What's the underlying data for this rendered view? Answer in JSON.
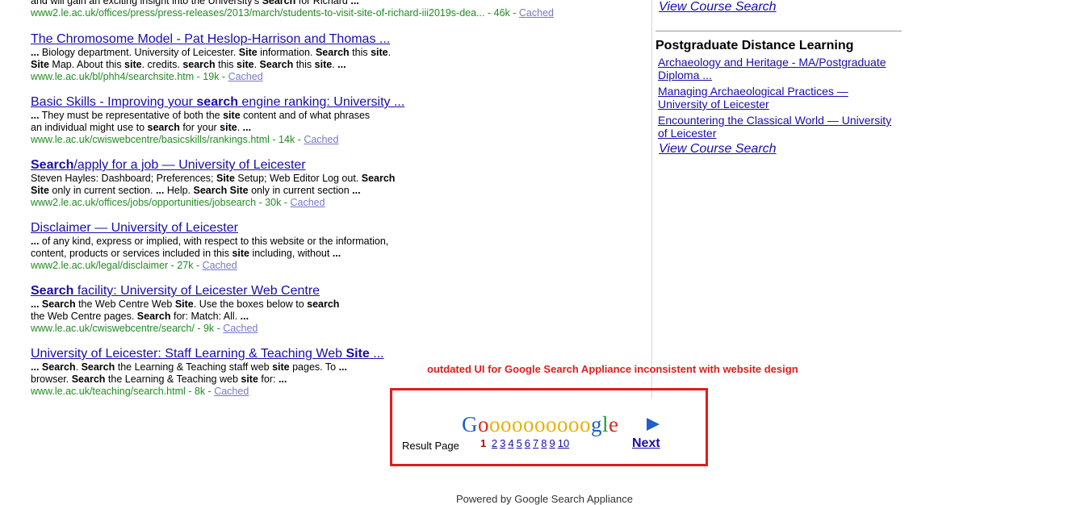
{
  "top_fragment": {
    "snippet_parts": [
      {
        "t": "and will gain an exciting insight into the University's ",
        "b": false
      },
      {
        "t": "Search",
        "b": true
      },
      {
        "t": " for Richard ",
        "b": false
      },
      {
        "t": "...",
        "b": true
      }
    ],
    "url": "www2.le.ac.uk/offices/press/press-releases/2013/march/students-to-visit-site-of-richard-iii2019s-dea...",
    "size": "46k",
    "cached": "Cached"
  },
  "results": [
    {
      "title_parts": [
        {
          "t": "The Chromosome Model - Pat Heslop-Harrison and Thomas ...",
          "b": false
        }
      ],
      "snippet_lines": [
        [
          {
            "t": "...",
            "b": true
          },
          {
            "t": " Biology department. University of Leicester. ",
            "b": false
          },
          {
            "t": "Site",
            "b": true
          },
          {
            "t": " information. ",
            "b": false
          },
          {
            "t": "Search",
            "b": true
          },
          {
            "t": " this ",
            "b": false
          },
          {
            "t": "site",
            "b": true
          },
          {
            "t": ".",
            "b": false
          }
        ],
        [
          {
            "t": "Site",
            "b": true
          },
          {
            "t": " Map. About this ",
            "b": false
          },
          {
            "t": "site",
            "b": true
          },
          {
            "t": ". credits. ",
            "b": false
          },
          {
            "t": "search",
            "b": true
          },
          {
            "t": " this ",
            "b": false
          },
          {
            "t": "site",
            "b": true
          },
          {
            "t": ". ",
            "b": false
          },
          {
            "t": "Search",
            "b": true
          },
          {
            "t": " this ",
            "b": false
          },
          {
            "t": "site",
            "b": true
          },
          {
            "t": ". ",
            "b": false
          },
          {
            "t": "...",
            "b": true
          }
        ]
      ],
      "url": "www.le.ac.uk/bl/phh4/searchsite.htm",
      "size": "19k",
      "cached": "Cached"
    },
    {
      "title_parts": [
        {
          "t": "Basic Skills - Improving your ",
          "b": false
        },
        {
          "t": "search",
          "b": true
        },
        {
          "t": " engine ranking: University ...",
          "b": false
        }
      ],
      "snippet_lines": [
        [
          {
            "t": "...",
            "b": true
          },
          {
            "t": " They must be representative of both the ",
            "b": false
          },
          {
            "t": "site",
            "b": true
          },
          {
            "t": " content and of what phrases",
            "b": false
          }
        ],
        [
          {
            "t": "an individual might use to ",
            "b": false
          },
          {
            "t": "search",
            "b": true
          },
          {
            "t": " for your ",
            "b": false
          },
          {
            "t": "site",
            "b": true
          },
          {
            "t": ". ",
            "b": false
          },
          {
            "t": "...",
            "b": true
          }
        ]
      ],
      "url": "www.le.ac.uk/cwiswebcentre/basicskills/rankings.html",
      "size": "14k",
      "cached": "Cached"
    },
    {
      "title_parts": [
        {
          "t": "Search",
          "b": true
        },
        {
          "t": "/apply for a job — University of Leicester",
          "b": false
        }
      ],
      "snippet_lines": [
        [
          {
            "t": "Steven Hayles: Dashboard; Preferences; ",
            "b": false
          },
          {
            "t": "Site",
            "b": true
          },
          {
            "t": " Setup; Web Editor Log out. ",
            "b": false
          },
          {
            "t": "Search",
            "b": true
          }
        ],
        [
          {
            "t": "Site",
            "b": true
          },
          {
            "t": " only in current section. ",
            "b": false
          },
          {
            "t": "...",
            "b": true
          },
          {
            "t": " Help. ",
            "b": false
          },
          {
            "t": "Search Site",
            "b": true
          },
          {
            "t": " only in current section ",
            "b": false
          },
          {
            "t": "...",
            "b": true
          }
        ]
      ],
      "url": "www2.le.ac.uk/offices/jobs/opportunities/jobsearch",
      "size": "30k",
      "cached": "Cached"
    },
    {
      "title_parts": [
        {
          "t": "Disclaimer — University of Leicester",
          "b": false
        }
      ],
      "snippet_lines": [
        [
          {
            "t": "...",
            "b": true
          },
          {
            "t": " of any kind, express or implied, with respect to this website or the information,",
            "b": false
          }
        ],
        [
          {
            "t": "content, products or services included in this ",
            "b": false
          },
          {
            "t": "site",
            "b": true
          },
          {
            "t": " including, without ",
            "b": false
          },
          {
            "t": "...",
            "b": true
          }
        ]
      ],
      "url": "www2.le.ac.uk/legal/disclaimer",
      "size": "27k",
      "cached": "Cached"
    },
    {
      "title_parts": [
        {
          "t": "Search",
          "b": true
        },
        {
          "t": " facility: University of Leicester Web Centre",
          "b": false
        }
      ],
      "snippet_lines": [
        [
          {
            "t": "...",
            "b": true
          },
          {
            "t": " ",
            "b": false
          },
          {
            "t": "Search",
            "b": true
          },
          {
            "t": " the Web Centre Web ",
            "b": false
          },
          {
            "t": "Site",
            "b": true
          },
          {
            "t": ". Use the boxes below to ",
            "b": false
          },
          {
            "t": "search",
            "b": true
          }
        ],
        [
          {
            "t": "the Web Centre pages. ",
            "b": false
          },
          {
            "t": "Search",
            "b": true
          },
          {
            "t": " for: Match: All. ",
            "b": false
          },
          {
            "t": "...",
            "b": true
          }
        ]
      ],
      "url": "www.le.ac.uk/cwiswebcentre/search/",
      "size": "9k",
      "cached": "Cached"
    },
    {
      "title_parts": [
        {
          "t": "University of Leicester: Staff Learning & Teaching Web ",
          "b": false
        },
        {
          "t": "Site",
          "b": true
        },
        {
          "t": " ...",
          "b": false
        }
      ],
      "snippet_lines": [
        [
          {
            "t": "...",
            "b": true
          },
          {
            "t": " ",
            "b": false
          },
          {
            "t": "Search",
            "b": true
          },
          {
            "t": ". ",
            "b": false
          },
          {
            "t": "Search",
            "b": true
          },
          {
            "t": " the Learning & Teaching staff web ",
            "b": false
          },
          {
            "t": "site",
            "b": true
          },
          {
            "t": " pages. To ",
            "b": false
          },
          {
            "t": "...",
            "b": true
          }
        ],
        [
          {
            "t": "browser. ",
            "b": false
          },
          {
            "t": "Search",
            "b": true
          },
          {
            "t": " the Learning & Teaching web ",
            "b": false
          },
          {
            "t": "site",
            "b": true
          },
          {
            "t": " for: ",
            "b": false
          },
          {
            "t": "...",
            "b": true
          }
        ]
      ],
      "url": "www.le.ac.uk/teaching/search.html",
      "size": "8k",
      "cached": "Cached"
    }
  ],
  "sidebar": {
    "top_view_course": "View Course Search",
    "heading": "Postgraduate Distance Learning",
    "items": [
      "Archaeology and Heritage - MA/Postgraduate Diploma ...",
      "Managing Archaeological Practices — University of Leicester",
      "Encountering the Classical World — University of Leicester"
    ],
    "bottom_view_course": "View Course Search"
  },
  "annotation": "outdated UI for Google Search Appliance inconsistent with website design",
  "pagination": {
    "logo_letters": [
      {
        "ch": "G",
        "color": "#1f5fc9"
      },
      {
        "ch": "o",
        "color": "#d62d20"
      },
      {
        "ch": "o",
        "color": "#e8b20e"
      },
      {
        "ch": "o",
        "color": "#e8b20e"
      },
      {
        "ch": "o",
        "color": "#e8b20e"
      },
      {
        "ch": "o",
        "color": "#e8b20e"
      },
      {
        "ch": "o",
        "color": "#e8b20e"
      },
      {
        "ch": "o",
        "color": "#e8b20e"
      },
      {
        "ch": "o",
        "color": "#e8b20e"
      },
      {
        "ch": "o",
        "color": "#e8b20e"
      },
      {
        "ch": "o",
        "color": "#e8b20e"
      },
      {
        "ch": "g",
        "color": "#1f5fc9"
      },
      {
        "ch": "l",
        "color": "#1e9e3a"
      },
      {
        "ch": "e",
        "color": "#d62d20"
      }
    ],
    "result_page_label": "Result Page",
    "current_page": "1",
    "pages": [
      "2",
      "3",
      "4",
      "5",
      "6",
      "7",
      "8",
      "9",
      "10"
    ],
    "next_label": "Next"
  },
  "footer": "Powered by Google Search Appliance"
}
